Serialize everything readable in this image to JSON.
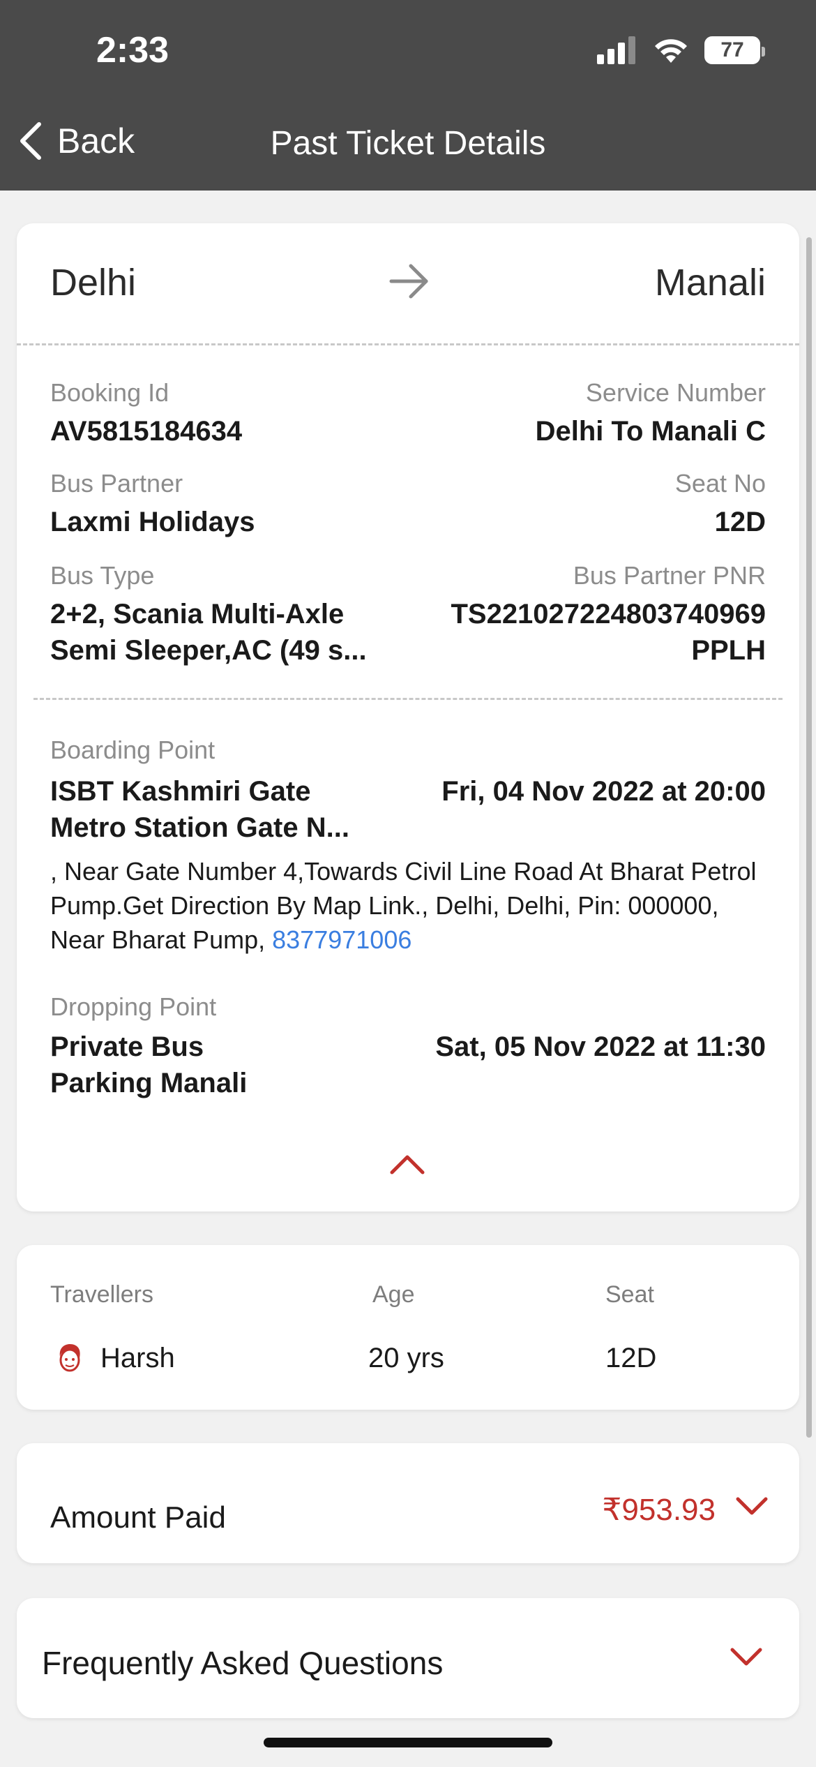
{
  "status_bar": {
    "time": "2:33",
    "battery": "77"
  },
  "nav": {
    "back_label": "Back",
    "title": "Past Ticket Details"
  },
  "route": {
    "from": "Delhi",
    "to": "Manali"
  },
  "details": {
    "booking_id_label": "Booking Id",
    "booking_id": "AV5815184634",
    "service_number_label": "Service Number",
    "service_number": "Delhi To Manali C",
    "bus_partner_label": "Bus Partner",
    "bus_partner": "Laxmi Holidays",
    "seat_no_label": "Seat No",
    "seat_no": "12D",
    "bus_type_label": "Bus Type",
    "bus_type_line1": "2+2, Scania Multi-Axle",
    "bus_type_line2": "Semi Sleeper,AC (49 s...",
    "pnr_label": "Bus Partner PNR",
    "pnr_line1": "TS221027224803740969",
    "pnr_line2": "PPLH"
  },
  "boarding": {
    "label": "Boarding Point",
    "name_line1": "ISBT Kashmiri Gate",
    "name_line2": "Metro Station Gate N...",
    "datetime": "Fri, 04 Nov 2022 at 20:00",
    "address": ", Near Gate Number 4,Towards Civil Line Road At Bharat Petrol Pump.Get Direction By Map Link., Delhi, Delhi, Pin: 000000, Near Bharat Pump, ",
    "phone": "8377971006"
  },
  "dropping": {
    "label": "Dropping Point",
    "name_line1": "Private Bus",
    "name_line2": "Parking Manali",
    "datetime": "Sat, 05 Nov 2022 at 11:30"
  },
  "travellers": {
    "headers": {
      "name": "Travellers",
      "age": "Age",
      "seat": "Seat"
    },
    "rows": [
      {
        "name": "Harsh",
        "age": "20 yrs",
        "seat": "12D"
      }
    ]
  },
  "amount": {
    "label": "Amount Paid",
    "value": "₹953.93"
  },
  "faq": {
    "label": "Frequently Asked Questions"
  },
  "colors": {
    "header_bg": "#4a4a4a",
    "accent_red": "#c2312c",
    "link_blue": "#3a7ee0"
  }
}
